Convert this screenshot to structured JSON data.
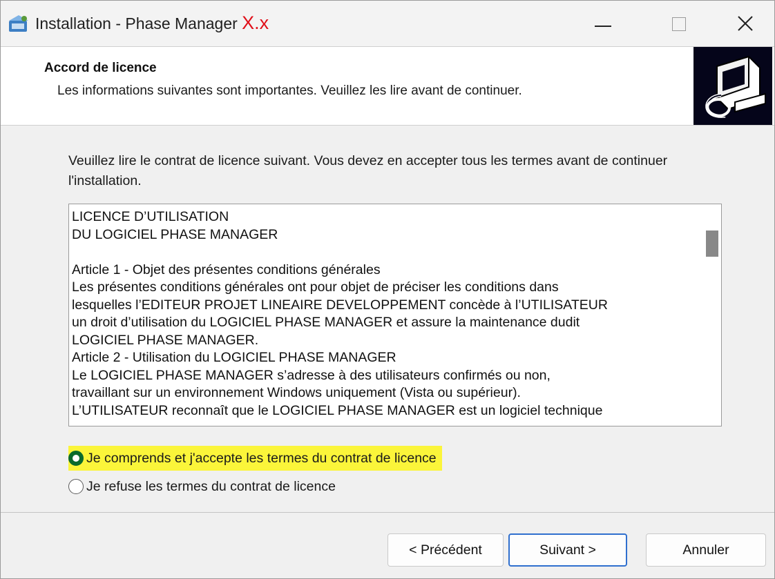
{
  "window": {
    "title": "Installation - Phase Manager",
    "title_version": "X.x",
    "app_icon": "installer-icon",
    "controls": {
      "minimize": "minimize-icon",
      "maximize": "maximize-icon",
      "close": "close-icon"
    }
  },
  "header": {
    "title": "Accord de licence",
    "subtitle": "Les informations suivantes sont importantes. Veuillez les lire avant de continuer.",
    "image_icon": "computer-install-icon"
  },
  "main": {
    "intro": "Veuillez lire le contrat de licence suivant. Vous devez en accepter tous les termes avant de continuer l'installation.",
    "license_text": "LICENCE D’UTILISATION\nDU LOGICIEL PHASE MANAGER\n\nArticle 1 - Objet des présentes conditions générales\nLes présentes conditions générales ont pour objet de préciser les conditions dans\nlesquelles l’EDITEUR PROJET LINEAIRE DEVELOPPEMENT concède à l’UTILISATEUR\nun droit d’utilisation du LOGICIEL PHASE MANAGER et assure la maintenance dudit\nLOGICIEL PHASE MANAGER.\nArticle 2 - Utilisation du LOGICIEL PHASE MANAGER\nLe LOGICIEL PHASE MANAGER s’adresse à des utilisateurs confirmés ou non,\ntravaillant sur un environnement Windows uniquement (Vista ou supérieur).\nL’UTILISATEUR reconnaît que le LOGICIEL PHASE MANAGER est un logiciel technique",
    "radio_accept": "Je comprends et j'accepte les termes du contrat de licence",
    "radio_refuse": "Je refuse les termes du contrat de licence",
    "selected": "accept",
    "highlight_color": "#fbf53a"
  },
  "footer": {
    "prev_label": "< Précédent",
    "next_label": "Suivant >",
    "cancel_label": "Annuler"
  }
}
